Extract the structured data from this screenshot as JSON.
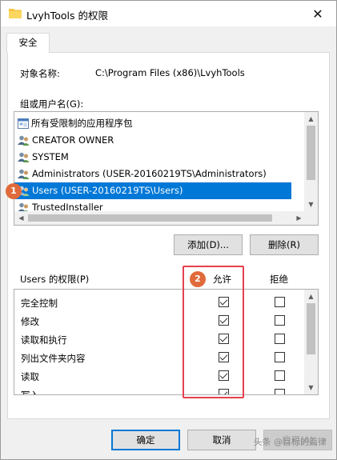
{
  "window": {
    "title": "LvyhTools 的权限",
    "close_glyph": "✕"
  },
  "tab": {
    "label": "安全"
  },
  "object": {
    "label": "对象名称:",
    "value": "C:\\Program Files (x86)\\LvyhTools"
  },
  "groups": {
    "label": "组或用户名(G):",
    "items": [
      {
        "label": "所有受限制的应用程序包",
        "icon": "app-package-icon"
      },
      {
        "label": "CREATOR OWNER",
        "icon": "users-icon"
      },
      {
        "label": "SYSTEM",
        "icon": "users-icon"
      },
      {
        "label": "Administrators (USER-20160219TS\\Administrators)",
        "icon": "users-icon"
      },
      {
        "label": "Users (USER-20160219TS\\Users)",
        "icon": "users-icon",
        "selected": true
      },
      {
        "label": "TrustedInstaller",
        "icon": "users-icon"
      }
    ]
  },
  "buttons": {
    "add": "添加(D)...",
    "remove": "删除(R)",
    "ok": "确定",
    "cancel": "取消",
    "apply": "应用(A)"
  },
  "permissions": {
    "label": "Users 的权限(P)",
    "allow_header": "允许",
    "deny_header": "拒绝",
    "rows": [
      {
        "name": "完全控制",
        "allow": true,
        "deny": false
      },
      {
        "name": "修改",
        "allow": true,
        "deny": false
      },
      {
        "name": "读取和执行",
        "allow": true,
        "deny": false
      },
      {
        "name": "列出文件夹内容",
        "allow": true,
        "deny": false
      },
      {
        "name": "读取",
        "allow": true,
        "deny": false
      },
      {
        "name": "写入",
        "allow": true,
        "deny": false
      }
    ]
  },
  "annotations": {
    "badge1": "1",
    "badge2": "2",
    "badge1_color": "#e06a3b",
    "badge2_color": "#e06a3b",
    "highlight_color": "#e5404f"
  },
  "watermark": "头条 @目标的篇律",
  "colors": {
    "selection": "#0078d7",
    "primary_border": "#0078d7"
  }
}
